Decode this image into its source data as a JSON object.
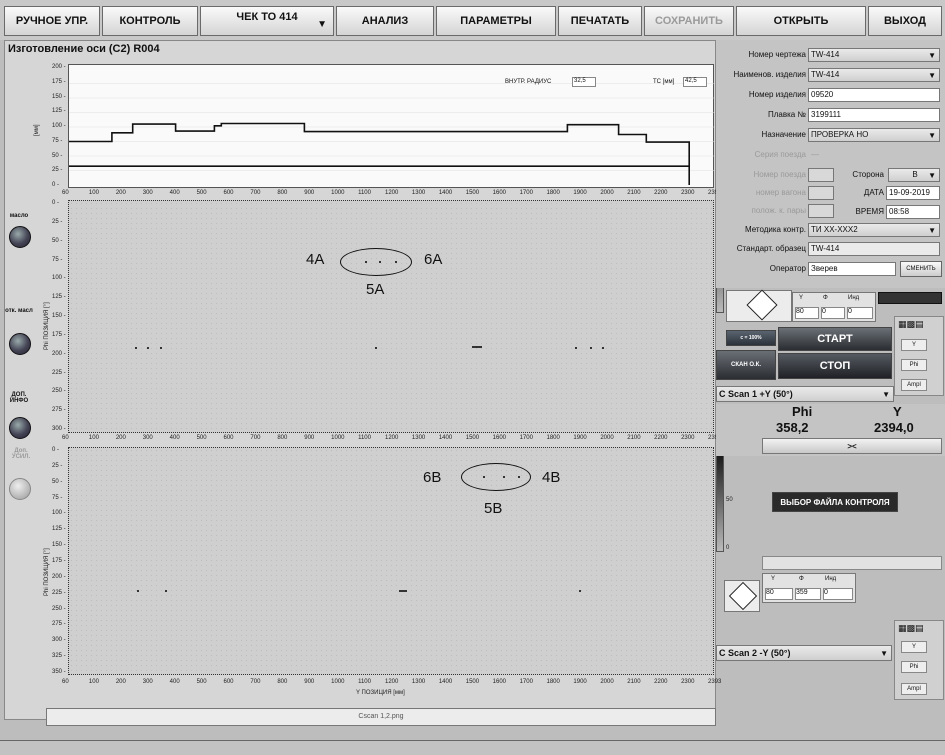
{
  "toolbar": {
    "manual": "РУЧНОЕ УПР.",
    "control": "КОНТРОЛЬ",
    "check": "ЧЕК ТО 414",
    "analysis": "АНАЛИЗ",
    "params": "ПАРАМЕТРЫ",
    "print": "ПЕЧАТАТЬ",
    "save": "СОХРАНИТЬ",
    "open": "ОТКРЫТЬ",
    "exit": "ВЫХОД"
  },
  "window_title": "Изготовление оси (С2) R004",
  "profile": {
    "yticks": [
      "200",
      "175",
      "150",
      "125",
      "100",
      "75",
      "50",
      "25",
      "0"
    ],
    "ylabel": "[мм]",
    "xticks": [
      "60",
      "100",
      "200",
      "300",
      "400",
      "500",
      "600",
      "700",
      "800",
      "900",
      "1000",
      "1100",
      "1200",
      "1300",
      "1400",
      "1500",
      "1600",
      "1700",
      "1800",
      "1900",
      "2000",
      "2100",
      "2200",
      "2300",
      "2393"
    ],
    "inner_radius_label": "ВНУТР. РАДИУС",
    "inner_radius_value": "32,5",
    "tc_label": "ТС [мм]",
    "tc_value": "42,5"
  },
  "scan_a": {
    "yticks": [
      "0",
      "25",
      "50",
      "75",
      "100",
      "125",
      "150",
      "175",
      "200",
      "225",
      "250",
      "275",
      "300"
    ],
    "ylabel": "Phi ПОЗИЦИЯ [°]",
    "xticks": [
      "60",
      "100",
      "200",
      "300",
      "400",
      "500",
      "600",
      "700",
      "800",
      "900",
      "1000",
      "1100",
      "1200",
      "1300",
      "1400",
      "1500",
      "1600",
      "1700",
      "1800",
      "1900",
      "2000",
      "2100",
      "2200",
      "2300",
      "2393"
    ],
    "scale": [
      "100",
      "50",
      "0"
    ],
    "ann_left": "4A",
    "ann_right": "6A",
    "ann_bottom": "5A"
  },
  "scan_b": {
    "yticks": [
      "0",
      "25",
      "50",
      "75",
      "100",
      "125",
      "150",
      "175",
      "200",
      "225",
      "250",
      "275",
      "300",
      "325",
      "350"
    ],
    "ylabel": "Phi ПОЗИЦИЯ [°]",
    "xticks": [
      "60",
      "100",
      "200",
      "300",
      "400",
      "500",
      "600",
      "700",
      "800",
      "900",
      "1000",
      "1100",
      "1200",
      "1300",
      "1400",
      "1500",
      "1600",
      "1700",
      "1800",
      "1900",
      "2000",
      "2100",
      "2200",
      "2300",
      "2393"
    ],
    "xlabel": "Y ПОЗИЦИЯ [мм]",
    "scale": [
      "100",
      "50",
      "0"
    ],
    "ann_left": "6B",
    "ann_right": "4B",
    "ann_bottom": "5B"
  },
  "side": {
    "oil": "масло",
    "oil_off": "отк. масл",
    "extra_info": "ДОП. ИНФО",
    "add_gain": "Доп. УСИЛ."
  },
  "form": {
    "drawing_label": "Номер чертежа",
    "drawing_value": "TW-414",
    "item_name_label": "Наименов. изделия",
    "item_name_value": "TW-414",
    "item_num_label": "Номер изделия",
    "item_num_value": "09520",
    "heat_label": "Плавка №",
    "heat_value": "3199111",
    "purpose_label": "Назначение",
    "purpose_value": "ПРОВЕРКА НО",
    "train_series_label": "Серия поезда",
    "train_series_value": "—",
    "train_num_label": "Номер поезда",
    "side_label": "Сторона",
    "side_value": "В",
    "wagon_label": "номер вагона",
    "date_label": "ДАТА",
    "date_value": "19-09-2019",
    "pair_label": "полож. к. пары",
    "time_label": "ВРЕМЯ",
    "time_value": "08:58",
    "method_label": "Методика контр.",
    "method_value": "ТИ ХХ-ХХХ2",
    "standard_label": "Стандарт. образец",
    "standard_value": "TW-414",
    "operator_label": "Оператор",
    "operator_value": "Зверев",
    "change_btn": "СМЕНИТЬ"
  },
  "ctrl1": {
    "col_y": "Y",
    "col_phi": "Φ",
    "col_ind": "Инд",
    "y": "80",
    "phi": "0",
    "ind": "0"
  },
  "buttons": {
    "c100": "с = 100%",
    "start": "СТАРТ",
    "scan_ok": "СКАН О.К.",
    "stop": "СТОП",
    "select_file": "ВЫБОР ФАЙЛА КОНТРОЛЯ",
    "center": "><"
  },
  "scan1_select": "C Scan 1  +Y (50°)",
  "readout": {
    "phi_label": "Phi",
    "phi_value": "358,2",
    "y_label": "Y",
    "y_value": "2394,0"
  },
  "side_mini": {
    "y": "Y",
    "phi": "Phi",
    "ampl": "Ampl"
  },
  "ctrl2": {
    "col_y": "Y",
    "col_phi": "Φ",
    "col_ind": "Инд",
    "y": "80",
    "phi": "359",
    "ind": "0"
  },
  "scan2_select": "C Scan 2  -Y (50°)",
  "status": "Cscan 1,2.png"
}
